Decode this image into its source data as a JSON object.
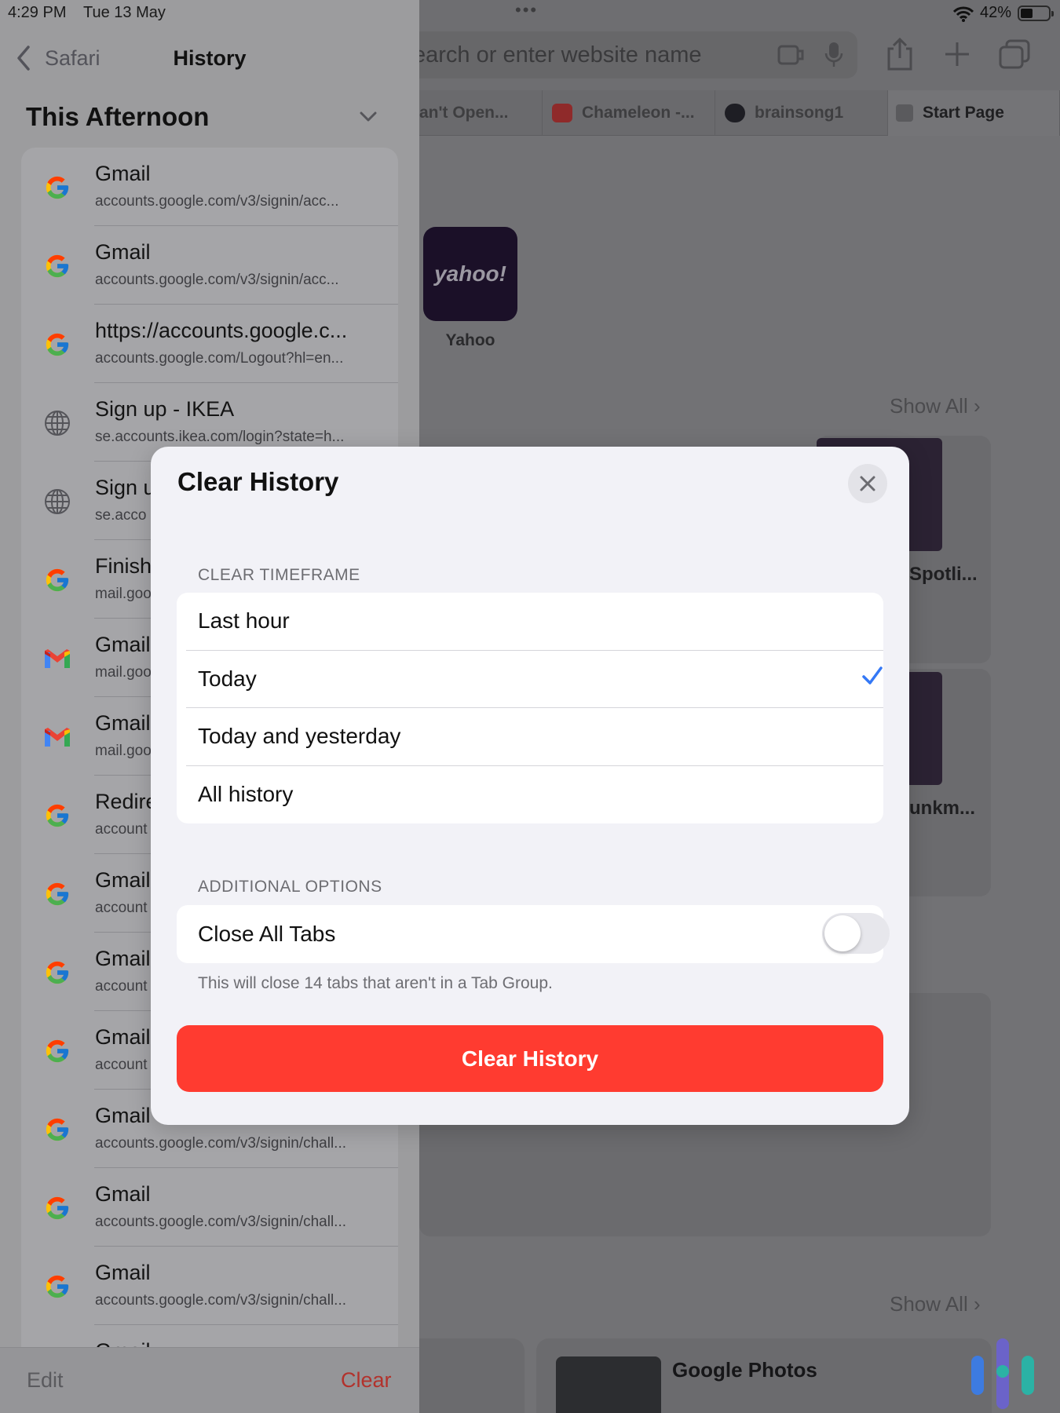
{
  "status_bar": {
    "time": "4:29 PM",
    "date": "Tue 13 May",
    "battery": "42%"
  },
  "browser": {
    "search_placeholder": "earch or enter website name",
    "tabs": [
      {
        "label": "an't Open...",
        "favicon_color": "#5a5a5d"
      },
      {
        "label": "Chameleon -...",
        "favicon_color": "#8f2a2a"
      },
      {
        "label": "brainsong1",
        "favicon_color": "#1e1e24"
      },
      {
        "label": "Start Page",
        "favicon_color": "#3b3b3e"
      }
    ],
    "favorite": {
      "label": "Yahoo",
      "logo_text": "yahoo!"
    },
    "show_all_top": "Show All",
    "show_all_bottom": "Show All",
    "card_text_1": "Spotli...",
    "card_text_2": "unkm...",
    "google_photos": "Google Photos"
  },
  "sidebar": {
    "back_label": "Safari",
    "title": "History",
    "section": "This Afternoon",
    "items": [
      {
        "title": "Gmail",
        "url": "accounts.google.com/v3/signin/acc...",
        "icon": "google-g-icon"
      },
      {
        "title": "Gmail",
        "url": "accounts.google.com/v3/signin/acc...",
        "icon": "google-g-icon"
      },
      {
        "title": "https://accounts.google.c...",
        "url": "accounts.google.com/Logout?hl=en...",
        "icon": "google-g-icon"
      },
      {
        "title": "Sign up - IKEA",
        "url": "se.accounts.ikea.com/login?state=h...",
        "icon": "globe-icon"
      },
      {
        "title": "Sign u",
        "url": "se.acco",
        "icon": "globe-icon"
      },
      {
        "title": "Finish",
        "url": "mail.goo",
        "icon": "google-g-icon"
      },
      {
        "title": "Gmail",
        "url": "mail.goo",
        "icon": "gmail-m-icon"
      },
      {
        "title": "Gmail",
        "url": "mail.goo",
        "icon": "gmail-m-icon"
      },
      {
        "title": "Redire",
        "url": "account",
        "icon": "google-g-icon"
      },
      {
        "title": "Gmail",
        "url": "account",
        "icon": "google-g-icon"
      },
      {
        "title": "Gmail",
        "url": "account",
        "icon": "google-g-icon"
      },
      {
        "title": "Gmail",
        "url": "account",
        "icon": "google-g-icon"
      },
      {
        "title": "Gmail",
        "url": "accounts.google.com/v3/signin/chall...",
        "icon": "google-g-icon"
      },
      {
        "title": "Gmail",
        "url": "accounts.google.com/v3/signin/chall...",
        "icon": "google-g-icon"
      },
      {
        "title": "Gmail",
        "url": "accounts.google.com/v3/signin/chall...",
        "icon": "google-g-icon"
      },
      {
        "title": "Gmail",
        "url": "",
        "icon": "google-g-icon"
      }
    ],
    "edit_label": "Edit",
    "clear_label": "Clear"
  },
  "modal": {
    "title": "Clear History",
    "timeframe_header": "CLEAR TIMEFRAME",
    "timeframe_options": [
      "Last hour",
      "Today",
      "Today and yesterday",
      "All history"
    ],
    "selected_timeframe": "Today",
    "additional_header": "ADDITIONAL OPTIONS",
    "close_tabs_label": "Close All Tabs",
    "close_tabs_enabled": false,
    "close_tabs_note": "This will close 14 tabs that aren't in a Tab Group.",
    "clear_button": "Clear History"
  },
  "colors": {
    "accent": "#3478f6",
    "destructive": "#ff3b30",
    "sidebar_clear": "#b2322c"
  }
}
